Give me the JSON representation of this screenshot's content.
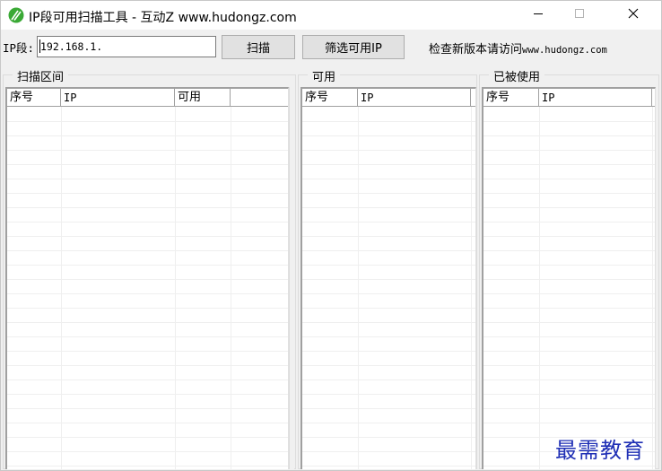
{
  "window": {
    "title": "IP段可用扫描工具  -  互动Z www.hudongz.com",
    "icon": "leaf-logo-icon",
    "controls": [
      "minimize-icon",
      "maximize-icon",
      "close-icon"
    ]
  },
  "toolbar": {
    "ip_label": "IP段:",
    "ip_value": "192.168.1.",
    "scan_label": "扫描",
    "filter_label": "筛选可用IP",
    "check_text": "检查新版本请访问",
    "check_url": "www.hudongz.com"
  },
  "groups": {
    "scan": {
      "title": "扫描区间",
      "columns": [
        "序号",
        "IP",
        "可用",
        ""
      ]
    },
    "available": {
      "title": "可用",
      "columns": [
        "序号",
        "IP"
      ]
    },
    "used": {
      "title": "已被使用",
      "columns": [
        "序号",
        "IP"
      ]
    }
  },
  "watermark": "最需教育",
  "colors": {
    "window_bg": "#f0f0f0",
    "list_bg": "#ffffff",
    "watermark": "#1f2fb5",
    "logo_green": "#3aa935"
  }
}
